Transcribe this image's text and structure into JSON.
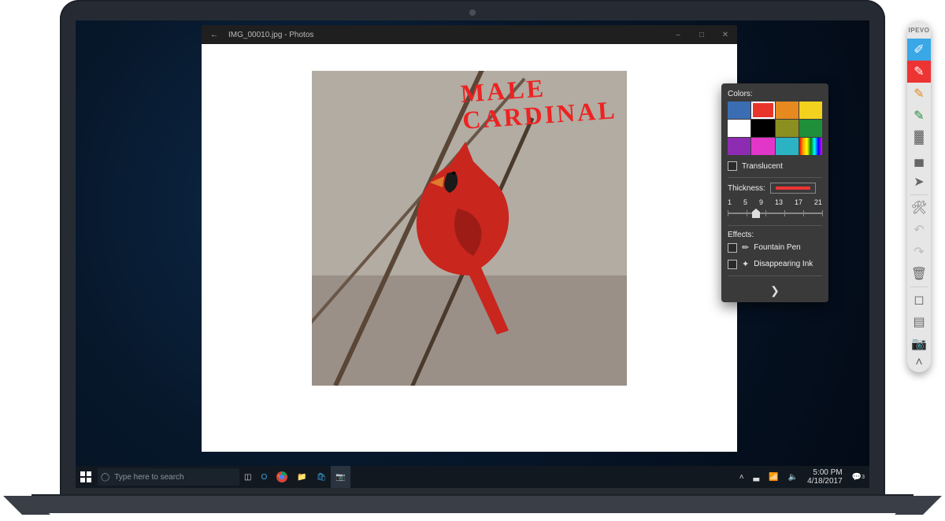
{
  "photos": {
    "title": "IMG_00010.jpg - Photos",
    "annotation_text": "MALE\nCARDINAL"
  },
  "taskbar": {
    "search_placeholder": "Type here to search",
    "time": "5:00 PM",
    "date": "4/18/2017",
    "tray_count": "3"
  },
  "ipevo": {
    "brand": "IPEVO"
  },
  "popup": {
    "colors_label": "Colors:",
    "translucent_label": "Translucent",
    "thickness_label": "Thickness:",
    "ticks": [
      "1",
      "5",
      "9",
      "13",
      "17",
      "21"
    ],
    "effects_label": "Effects:",
    "effect1": "Fountain Pen",
    "effect2": "Disappearing Ink",
    "swatches": [
      "#3b6db3",
      "#e8342b",
      "#e68a1f",
      "#f2d21f",
      "#ffffff",
      "#000000",
      "#8a8f1f",
      "#1f8f3b",
      "#8e2bb3",
      "#e236c9",
      "#2bb3c4",
      "#c8c8c8"
    ],
    "selected_swatch_index": 1,
    "thickness_value": 7,
    "thickness_min": 1,
    "thickness_max": 21
  }
}
